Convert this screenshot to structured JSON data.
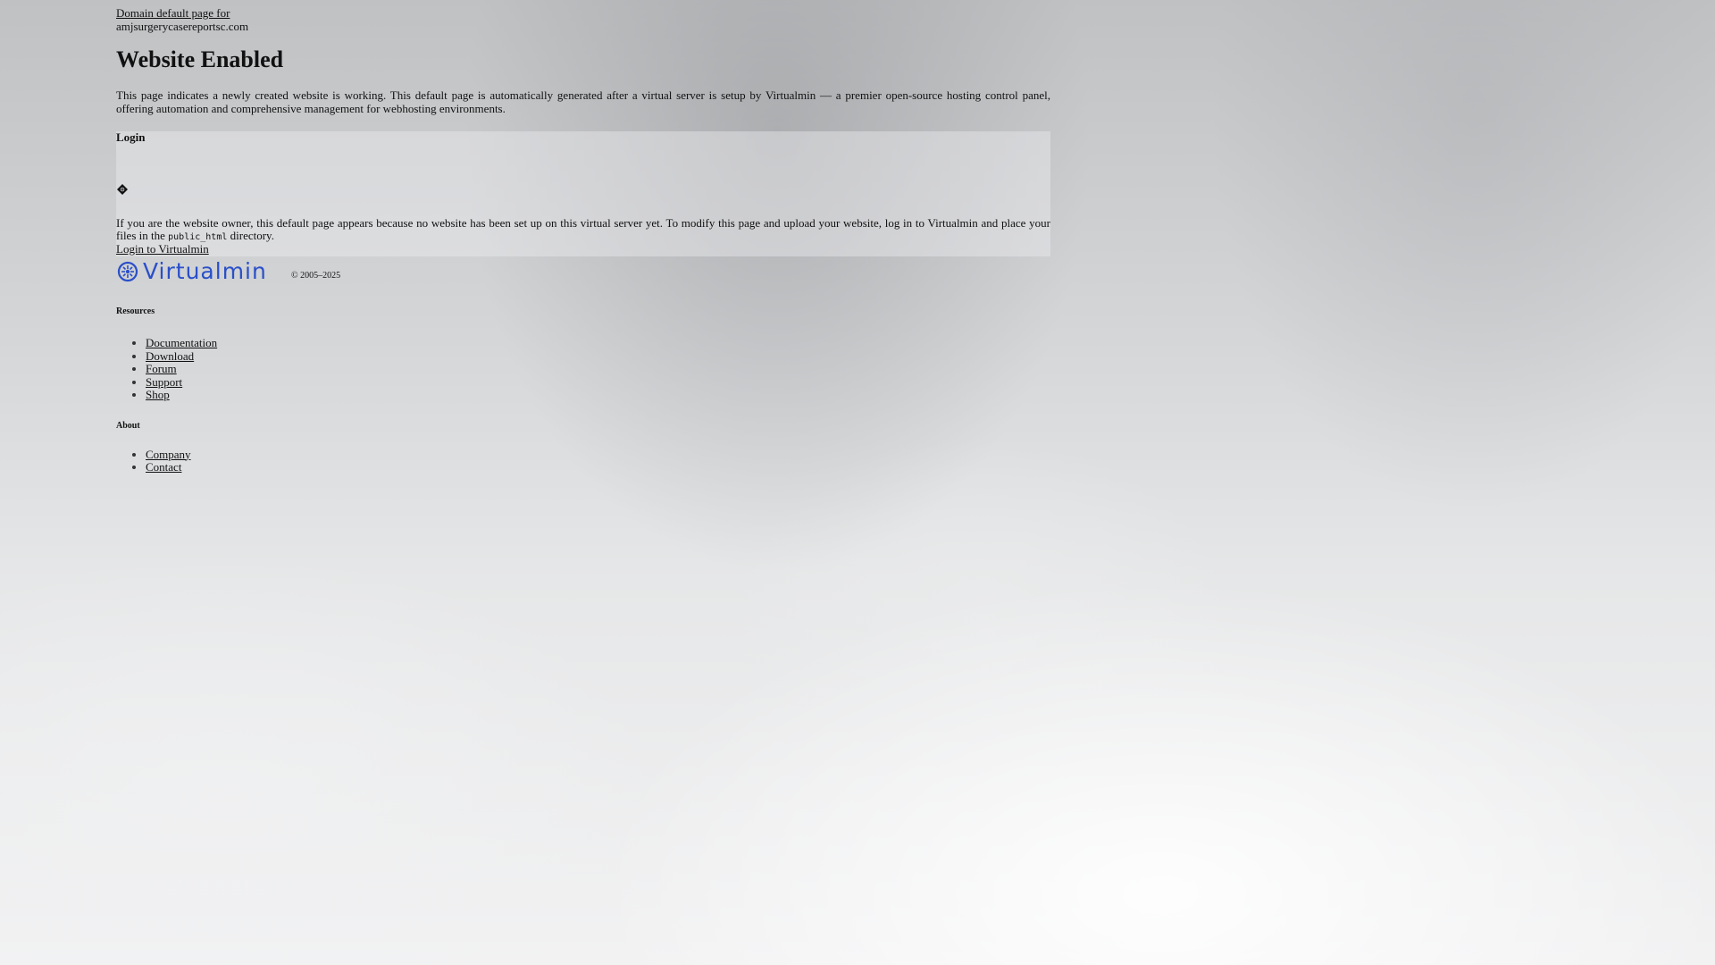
{
  "header": {
    "domain_link_label": "Domain default page for",
    "domain_name": "amjsurgerycasereportsc.com"
  },
  "main": {
    "title": "Website Enabled",
    "intro": "This page indicates a newly created website is working. This default page is automatically generated after a virtual server is setup by Virtualmin — a premier open-source hosting control panel, offering automation and comprehensive management for webhosting environments."
  },
  "login": {
    "title": "Login",
    "icon": "diamond-icon",
    "owner_text_before": "If you are the website owner, this default page appears because no website has been set up on this virtual server yet. To modify this page and upload your website, log in to Virtualmin and place your files in the ",
    "owner_text_code": "public_html",
    "owner_text_after": " directory.",
    "login_link_label": "Login to Virtualmin"
  },
  "footer": {
    "logo_text": "Virtualmin",
    "logo_color": "#2a4fc9",
    "copyright": "© 2005–2025"
  },
  "resources": {
    "title": "Resources",
    "items": [
      {
        "label": "Documentation"
      },
      {
        "label": "Download"
      },
      {
        "label": "Forum"
      },
      {
        "label": "Support"
      },
      {
        "label": "Shop"
      }
    ]
  },
  "about": {
    "title": "About",
    "items": [
      {
        "label": "Company"
      },
      {
        "label": "Contact"
      }
    ]
  }
}
